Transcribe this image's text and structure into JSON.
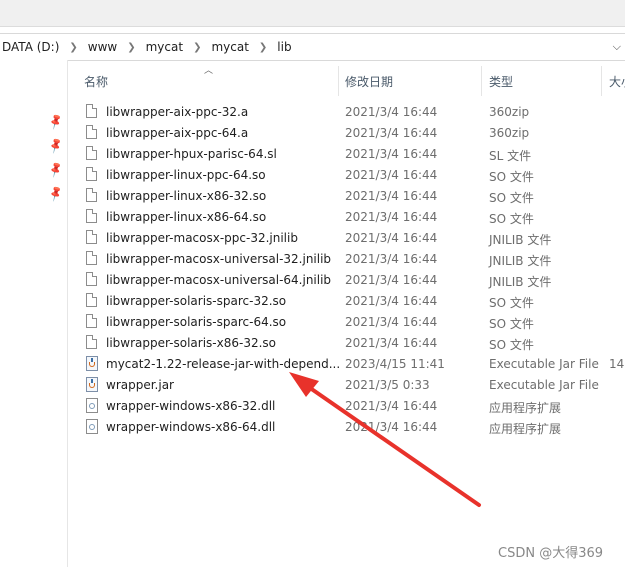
{
  "breadcrumbs": [
    "DATA (D:)",
    "www",
    "mycat",
    "mycat",
    "lib"
  ],
  "columns": {
    "name": "名称",
    "date": "修改日期",
    "type": "类型",
    "size": "大小"
  },
  "files": [
    {
      "name": "libwrapper-aix-ppc-32.a",
      "date": "2021/3/4 16:44",
      "type": "360zip",
      "size": "",
      "icon": "file-icon"
    },
    {
      "name": "libwrapper-aix-ppc-64.a",
      "date": "2021/3/4 16:44",
      "type": "360zip",
      "size": "",
      "icon": "file-icon"
    },
    {
      "name": "libwrapper-hpux-parisc-64.sl",
      "date": "2021/3/4 16:44",
      "type": "SL 文件",
      "size": "",
      "icon": "file-icon"
    },
    {
      "name": "libwrapper-linux-ppc-64.so",
      "date": "2021/3/4 16:44",
      "type": "SO 文件",
      "size": "",
      "icon": "file-icon"
    },
    {
      "name": "libwrapper-linux-x86-32.so",
      "date": "2021/3/4 16:44",
      "type": "SO 文件",
      "size": "",
      "icon": "file-icon"
    },
    {
      "name": "libwrapper-linux-x86-64.so",
      "date": "2021/3/4 16:44",
      "type": "SO 文件",
      "size": "",
      "icon": "file-icon"
    },
    {
      "name": "libwrapper-macosx-ppc-32.jnilib",
      "date": "2021/3/4 16:44",
      "type": "JNILIB 文件",
      "size": "",
      "icon": "file-icon"
    },
    {
      "name": "libwrapper-macosx-universal-32.jnilib",
      "date": "2021/3/4 16:44",
      "type": "JNILIB 文件",
      "size": "",
      "icon": "file-icon"
    },
    {
      "name": "libwrapper-macosx-universal-64.jnilib",
      "date": "2021/3/4 16:44",
      "type": "JNILIB 文件",
      "size": "",
      "icon": "file-icon"
    },
    {
      "name": "libwrapper-solaris-sparc-32.so",
      "date": "2021/3/4 16:44",
      "type": "SO 文件",
      "size": "",
      "icon": "file-icon"
    },
    {
      "name": "libwrapper-solaris-sparc-64.so",
      "date": "2021/3/4 16:44",
      "type": "SO 文件",
      "size": "",
      "icon": "file-icon"
    },
    {
      "name": "libwrapper-solaris-x86-32.so",
      "date": "2021/3/4 16:44",
      "type": "SO 文件",
      "size": "",
      "icon": "file-icon"
    },
    {
      "name": "mycat2-1.22-release-jar-with-depend...",
      "date": "2023/4/15 11:41",
      "type": "Executable Jar File",
      "size": "14",
      "icon": "java-jar-icon"
    },
    {
      "name": "wrapper.jar",
      "date": "2021/3/5 0:33",
      "type": "Executable Jar File",
      "size": "",
      "icon": "java-jar-icon"
    },
    {
      "name": "wrapper-windows-x86-32.dll",
      "date": "2021/3/4 16:44",
      "type": "应用程序扩展",
      "size": "",
      "icon": "dll-icon"
    },
    {
      "name": "wrapper-windows-x86-64.dll",
      "date": "2021/3/4 16:44",
      "type": "应用程序扩展",
      "size": "",
      "icon": "dll-icon"
    }
  ],
  "watermark": "CSDN @大得369",
  "colors": {
    "annotation_arrow": "#e8322b"
  }
}
